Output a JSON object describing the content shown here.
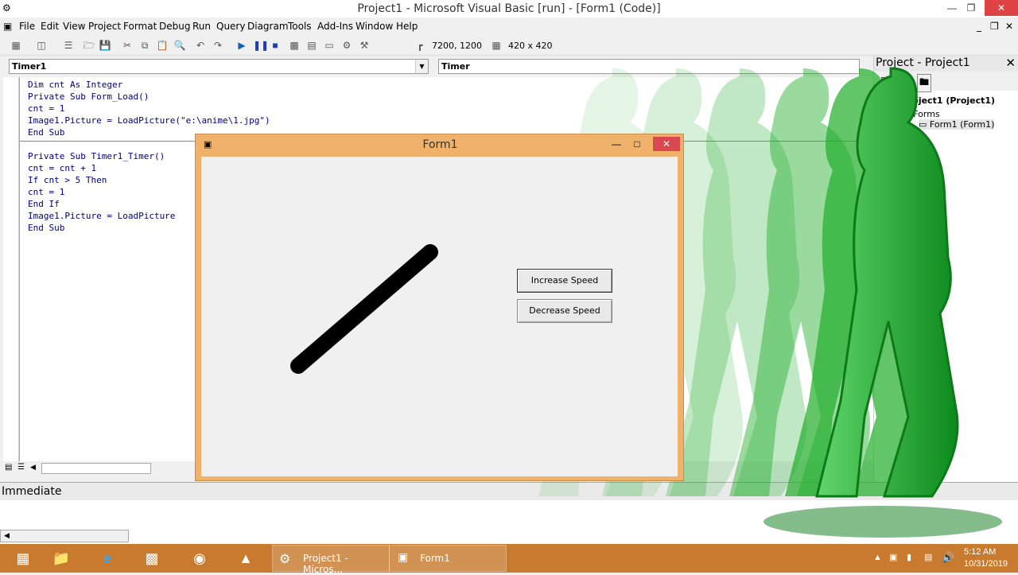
{
  "window": {
    "title": "Project1 - Microsoft Visual Basic [run] - [Form1 (Code)]"
  },
  "menu": [
    "File",
    "Edit",
    "View",
    "Project",
    "Format",
    "Debug",
    "Run",
    "Query",
    "Diagram",
    "Tools",
    "Add-Ins",
    "Window",
    "Help"
  ],
  "toolbar": {
    "position": "7200, 1200",
    "size": "420 x 420"
  },
  "code": {
    "object_combo": "Timer1",
    "proc_combo": "Timer",
    "lines": [
      "Dim cnt As Integer",
      "Private Sub Form_Load()",
      "cnt = 1",
      "Image1.Picture = LoadPicture(\"e:\\anime\\1.jpg\")",
      "End Sub",
      "Private Sub Timer1_Timer()",
      "cnt = cnt + 1",
      "If cnt > 5 Then",
      "cnt = 1",
      "End If",
      "Image1.Picture = LoadPicture",
      "End Sub"
    ]
  },
  "project": {
    "title": "Project - Project1",
    "root": "Project1 (Project1)",
    "folder": "Forms",
    "item": "Form1 (Form1)"
  },
  "immediate": {
    "title": "Immediate"
  },
  "form1": {
    "title": "Form1",
    "increase_label": "Increase Speed",
    "decrease_label": "Decrease Speed"
  },
  "taskbar": {
    "vb_window": "Project1 - Micros...",
    "form_window": "Form1",
    "time": "5:12 AM",
    "date": "10/31/2019"
  },
  "colors": {
    "taskbar": "#c87b2f",
    "form_frame": "#f0b26a",
    "code_text": "#000080",
    "walker": "#1fae2a"
  }
}
